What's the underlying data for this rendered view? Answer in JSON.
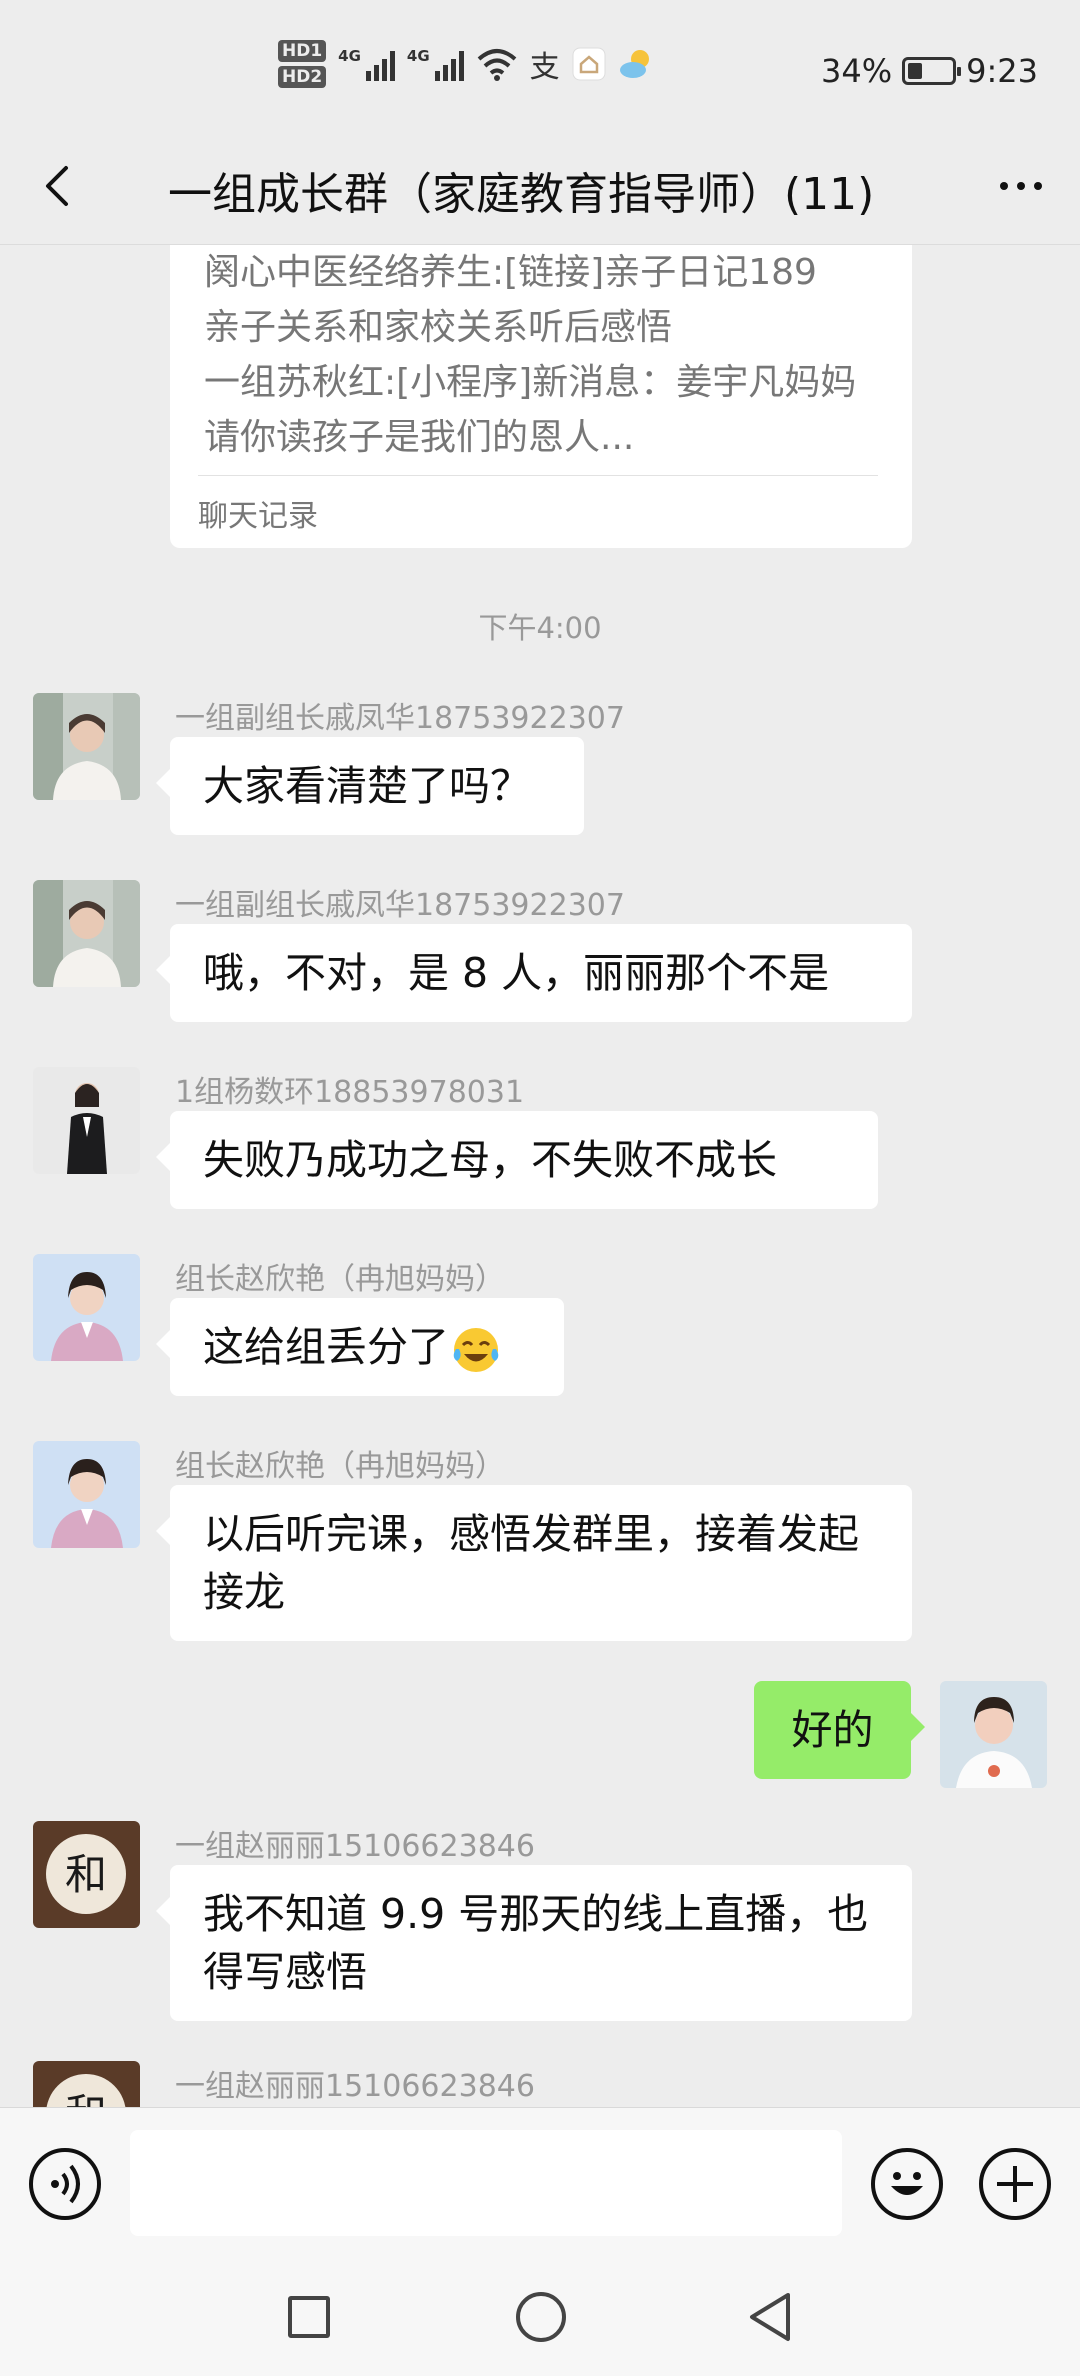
{
  "status_bar": {
    "hd1": "HD1",
    "hd2": "HD2",
    "net1": "4G",
    "net2": "4G",
    "battery_text": "34%",
    "battery_level": 0.34,
    "time": "9:23"
  },
  "header": {
    "title": "一组成长群（家庭教育指导师）(11)",
    "back_icon": "chevron-left-icon",
    "more_icon": "more-dots-icon"
  },
  "forwarded_card": {
    "lines": [
      "阕心中医经络养生:[链接]亲子日记189",
      "亲子关系和家校关系听后感悟",
      "一组苏秋红:[小程序]新消息：姜宇凡妈妈",
      "请你读孩子是我们的恩人..."
    ],
    "footer": "聊天记录"
  },
  "timestamp": "下午4:00",
  "messages": [
    {
      "sender": "一组副组长戚凤华18753922307",
      "text": "大家看清楚了吗？"
    },
    {
      "sender": "一组副组长戚凤华18753922307",
      "text": "哦，不对，是 8 人，丽丽那个不是"
    },
    {
      "sender": "1组杨数环18853978031",
      "text": "失败乃成功之母，不失败不成长"
    },
    {
      "sender": "组长赵欣艳（冉旭妈妈）",
      "text": "这给组丢分了",
      "emoji": "crying-laughing-emoji"
    },
    {
      "sender": "组长赵欣艳（冉旭妈妈）",
      "text": "以后听完课，感悟发群里，接着发起接龙"
    },
    {
      "sender": "",
      "text": "好的",
      "outgoing": true
    },
    {
      "sender": "一组赵丽丽15106623846",
      "text": "我不知道 9.9 号那天的线上直播，也得写感悟"
    },
    {
      "sender": "一组赵丽丽15106623846",
      "text": ""
    }
  ],
  "input_bar": {
    "voice_icon": "voice-icon",
    "emoji_icon": "emoji-icon",
    "add_icon": "add-icon",
    "input_value": ""
  },
  "nav": {
    "recent_icon": "recent-apps-icon",
    "home_icon": "home-icon",
    "back_icon": "back-triangle-icon"
  },
  "colors": {
    "background": "#ededed",
    "outgoing_bubble": "#95ec69",
    "incoming_bubble": "#ffffff",
    "meta_text": "#999999"
  }
}
